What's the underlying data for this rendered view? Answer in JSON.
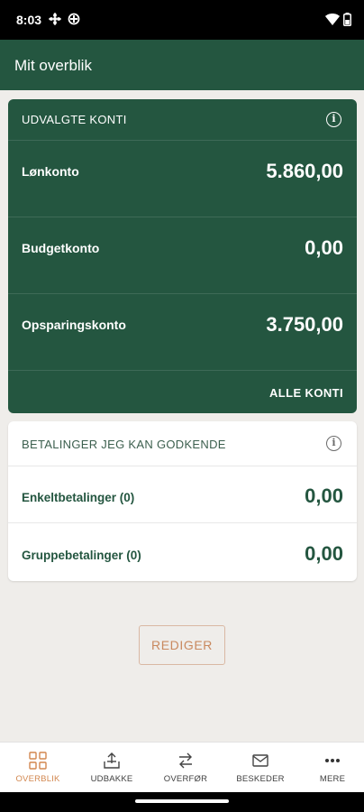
{
  "status_bar": {
    "time": "8:03"
  },
  "app_bar": {
    "title": "Mit overblik"
  },
  "accounts_card": {
    "header": "UDVALGTE KONTI",
    "accounts": [
      {
        "name": "Lønkonto",
        "balance": "5.860,00"
      },
      {
        "name": "Budgetkonto",
        "balance": "0,00"
      },
      {
        "name": "Opsparingskonto",
        "balance": "3.750,00"
      }
    ],
    "all_accounts_label": "ALLE KONTI"
  },
  "payments_card": {
    "header": "BETALINGER JEG KAN GODKENDE",
    "items": [
      {
        "name": "Enkeltbetalinger (0)",
        "value": "0,00"
      },
      {
        "name": "Gruppebetalinger (0)",
        "value": "0,00"
      }
    ]
  },
  "edit_button": {
    "label": "REDIGER"
  },
  "bottom_nav": {
    "items": [
      {
        "label": "OVERBLIK",
        "icon": "grid-icon",
        "active": true
      },
      {
        "label": "UDBAKKE",
        "icon": "outbox-icon",
        "active": false
      },
      {
        "label": "OVERFØR",
        "icon": "transfer-icon",
        "active": false
      },
      {
        "label": "BESKEDER",
        "icon": "mail-icon",
        "active": false
      },
      {
        "label": "MERE",
        "icon": "more-icon",
        "active": false
      }
    ]
  },
  "colors": {
    "primary_green": "#245640",
    "accent_orange": "#d2874f"
  }
}
